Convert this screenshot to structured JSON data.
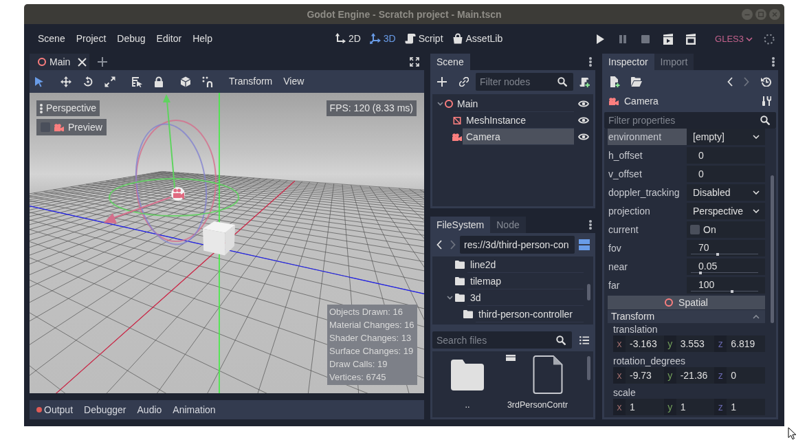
{
  "window": {
    "title": "Godot Engine - Scratch project - Main.tscn"
  },
  "menu": [
    "Scene",
    "Project",
    "Debug",
    "Editor",
    "Help"
  ],
  "workspaces": [
    {
      "label": "2D",
      "kind": "planar",
      "selected": false
    },
    {
      "label": "3D",
      "kind": "spatial",
      "selected": true
    },
    {
      "label": "Script",
      "kind": "script",
      "selected": false
    },
    {
      "label": "AssetLib",
      "kind": "assetlib",
      "selected": false
    }
  ],
  "run_controls": [
    {
      "kind": "play",
      "disabled": false
    },
    {
      "kind": "pause",
      "disabled": true
    },
    {
      "kind": "stop",
      "disabled": true
    },
    {
      "kind": "playscene",
      "disabled": false
    },
    {
      "kind": "playcustom",
      "disabled": false
    }
  ],
  "renderer": "GLES3",
  "scene_tabs": [
    {
      "label": "Main",
      "selected": true
    }
  ],
  "viewport_toolbar": {
    "tools": [
      {
        "kind": "select",
        "selected": true
      },
      {
        "kind": "move",
        "selected": false
      },
      {
        "kind": "rotate",
        "selected": false
      },
      {
        "kind": "scale",
        "selected": false
      },
      {
        "kind": "listselect",
        "selected": false
      },
      {
        "kind": "lock",
        "selected": false
      },
      {
        "kind": "local",
        "selected": false
      },
      {
        "kind": "snap",
        "selected": false
      }
    ],
    "menus": [
      "Transform",
      "View"
    ]
  },
  "viewport": {
    "view_menu": "Perspective",
    "preview": {
      "label": "Preview",
      "checked": false
    },
    "fps": "FPS: 120 (8.33 ms)",
    "stats": [
      "Objects Drawn: 16",
      "Material Changes: 16",
      "Shader Changes: 13",
      "Surface Changes: 19",
      "Draw Calls: 19",
      "Vertices: 6745"
    ]
  },
  "bottom_tabs": [
    {
      "label": "Output",
      "alert": true,
      "selected": false
    },
    {
      "label": "Debugger",
      "alert": false,
      "selected": false
    },
    {
      "label": "Audio",
      "alert": false,
      "selected": false
    },
    {
      "label": "Animation",
      "alert": false,
      "selected": false
    }
  ],
  "scene_dock": {
    "tabs": [
      {
        "label": "Scene",
        "selected": true
      }
    ],
    "filter_placeholder": "Filter nodes",
    "tree": [
      {
        "name": "Main",
        "kind": "spatial",
        "expanded": true,
        "selected": false,
        "children": [
          {
            "name": "MeshInstance",
            "kind": "mesh",
            "selected": false
          },
          {
            "name": "Camera",
            "kind": "camera",
            "selected": true
          }
        ]
      }
    ]
  },
  "filesystem_dock": {
    "tabs": [
      {
        "label": "FileSystem",
        "selected": true
      },
      {
        "label": "Node",
        "selected": false
      }
    ],
    "nav": [
      {
        "kind": "back",
        "disabled": false
      },
      {
        "kind": "forward",
        "disabled": true
      }
    ],
    "path": "res://3d/third-person-con",
    "tree": [
      {
        "name": "line2d",
        "selected": false
      },
      {
        "name": "tilemap",
        "selected": false
      },
      {
        "name": "3d",
        "expanded": true,
        "selected": false,
        "children": [
          {
            "name": "third-person-controller",
            "selected": false
          }
        ]
      }
    ],
    "search_placeholder": "Search files",
    "files": [
      {
        "name": "..",
        "kind": "folder",
        "selected": false
      },
      {
        "name": "3rdPersonContr",
        "kind": "scene",
        "selected": false
      }
    ]
  },
  "inspector": {
    "tabs": [
      {
        "label": "Inspector",
        "selected": true
      },
      {
        "label": "Import",
        "selected": false
      }
    ],
    "nav": [
      {
        "kind": "back",
        "disabled": false
      },
      {
        "kind": "forward",
        "disabled": true
      }
    ],
    "object": {
      "name": "Camera",
      "kind": "camera"
    },
    "filter_placeholder": "Filter properties",
    "properties": [
      {
        "name": "environment",
        "kind": "dropdown",
        "value": "[empty]",
        "selected": true
      },
      {
        "name": "h_offset",
        "kind": "number",
        "value": "0",
        "selected": false
      },
      {
        "name": "v_offset",
        "kind": "number",
        "value": "0",
        "selected": false
      },
      {
        "name": "doppler_tracking",
        "kind": "dropdown",
        "value": "Disabled",
        "selected": false
      },
      {
        "name": "projection",
        "kind": "dropdown",
        "value": "Perspective",
        "selected": false
      },
      {
        "name": "current",
        "kind": "checkbox",
        "value": "On",
        "checked": false,
        "selected": false
      },
      {
        "name": "fov",
        "kind": "slider",
        "value": "70",
        "level": 0.39,
        "selected": false
      },
      {
        "name": "near",
        "kind": "slider",
        "value": "0.05",
        "level": 0.13,
        "selected": false
      },
      {
        "name": "far",
        "kind": "slider",
        "value": "100",
        "level": 0.62,
        "selected": false
      }
    ],
    "class_header": "Spatial",
    "group": {
      "title": "Transform",
      "expanded": true,
      "vectors": [
        {
          "name": "translation",
          "components": [
            {
              "axis": "x",
              "value": "-3.163",
              "color": "#9b6a6a"
            },
            {
              "axis": "y",
              "value": "3.553",
              "color": "#73a05a"
            },
            {
              "axis": "z",
              "value": "6.819",
              "color": "#6767ad"
            }
          ]
        },
        {
          "name": "rotation_degrees",
          "components": [
            {
              "axis": "x",
              "value": "-9.73",
              "color": "#9b6a6a"
            },
            {
              "axis": "y",
              "value": "-21.36",
              "color": "#73a05a"
            },
            {
              "axis": "z",
              "value": "0",
              "color": "#6767ad"
            }
          ]
        },
        {
          "name": "scale",
          "components": [
            {
              "axis": "x",
              "value": "1",
              "color": "#9b6a6a"
            },
            {
              "axis": "y",
              "value": "1",
              "color": "#73a05a"
            },
            {
              "axis": "z",
              "value": "1",
              "color": "#6767ad"
            }
          ]
        }
      ]
    }
  }
}
